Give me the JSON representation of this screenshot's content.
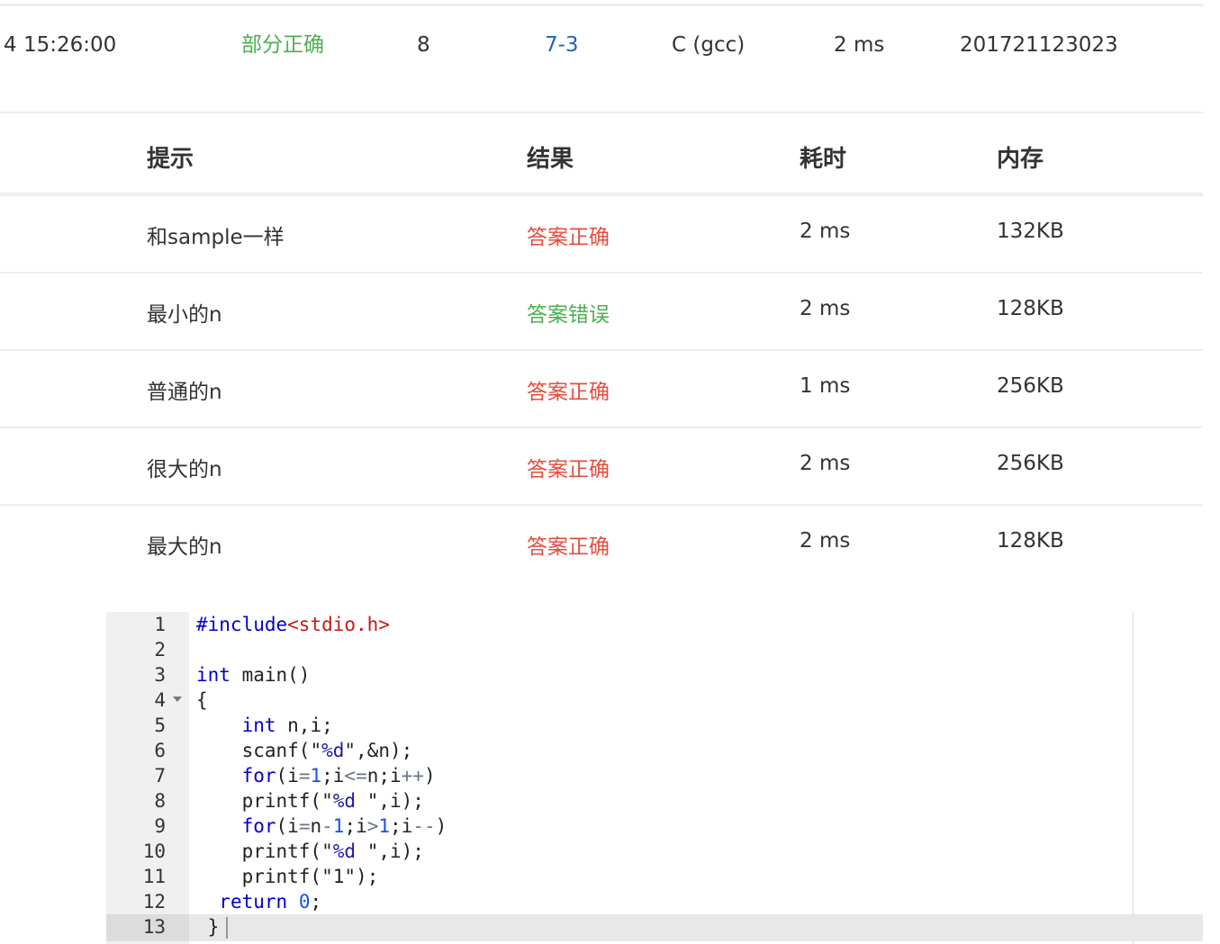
{
  "submission": {
    "time": "4 15:26:00",
    "status": "部分正确",
    "score": "8",
    "problem": "7-3",
    "language": "C (gcc)",
    "cost_time": "2 ms",
    "user": "201721123023"
  },
  "table": {
    "headers": {
      "hint": "提示",
      "result": "结果",
      "time": "耗时",
      "memory": "内存"
    },
    "rows": [
      {
        "hint": "和sample一样",
        "result": "答案正确",
        "time": "2 ms",
        "memory": "132KB",
        "status": "ok"
      },
      {
        "hint": "最小的n",
        "result": "答案错误",
        "time": "2 ms",
        "memory": "128KB",
        "status": "wrong"
      },
      {
        "hint": "普通的n",
        "result": "答案正确",
        "time": "1 ms",
        "memory": "256KB",
        "status": "ok"
      },
      {
        "hint": "很大的n",
        "result": "答案正确",
        "time": "2 ms",
        "memory": "256KB",
        "status": "ok"
      },
      {
        "hint": "最大的n",
        "result": "答案正确",
        "time": "2 ms",
        "memory": "128KB",
        "status": "ok"
      }
    ]
  },
  "colors": {
    "correct": "#e74c3c",
    "wrong": "#4caf50",
    "partial": "#4caf50",
    "link": "#1e64b4"
  },
  "code": {
    "line_numbers": [
      "1",
      "2",
      "3",
      "4",
      "5",
      "6",
      "7",
      "8",
      "9",
      "10",
      "11",
      "12",
      "13"
    ],
    "lines": [
      "#include<stdio.h>",
      "",
      "int main()",
      "{",
      "    int n,i;",
      "    scanf(\"%d\",&n);",
      "    for(i=1;i<=n;i++)",
      "    printf(\"%d \",i);",
      "    for(i=n-1;i>1;i--)",
      "    printf(\"%d \",i);",
      "    printf(\"1\");",
      "  return 0;",
      " }"
    ],
    "fold_line": 4,
    "active_line": 13
  }
}
